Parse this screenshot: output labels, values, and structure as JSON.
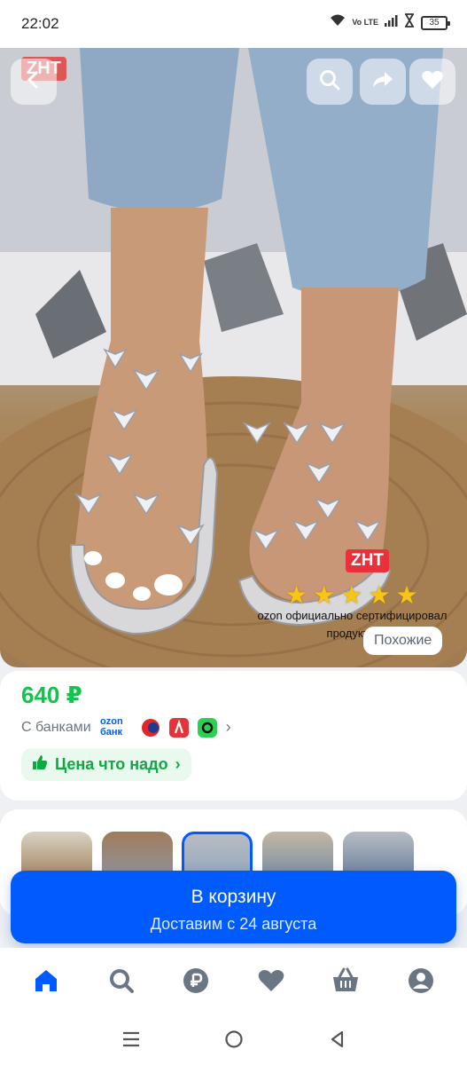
{
  "status_bar": {
    "time": "22:02",
    "network_label": "Vo LTE",
    "battery": "35"
  },
  "product_image": {
    "brand_tag_top": "ZHT",
    "brand_tag_bottom": "ZHT",
    "rating_stars": 5,
    "certificate_text": "ozon официально сертифицировал продукт 5",
    "similar_button": "Похожие"
  },
  "price_block": {
    "price": "640 ₽",
    "banks_label": "С банками",
    "ozon_bank_logo": "ozon банк",
    "price_promise": "Цена что надо"
  },
  "thumbnails": {
    "count": 5,
    "selected_index": 2
  },
  "cart": {
    "title": "В корзину",
    "delivery": "Доставим с 24 августа"
  },
  "colors": {
    "accent": "#005bff",
    "price_green": "#10c44c",
    "badge_bg": "#e9f9ee"
  }
}
